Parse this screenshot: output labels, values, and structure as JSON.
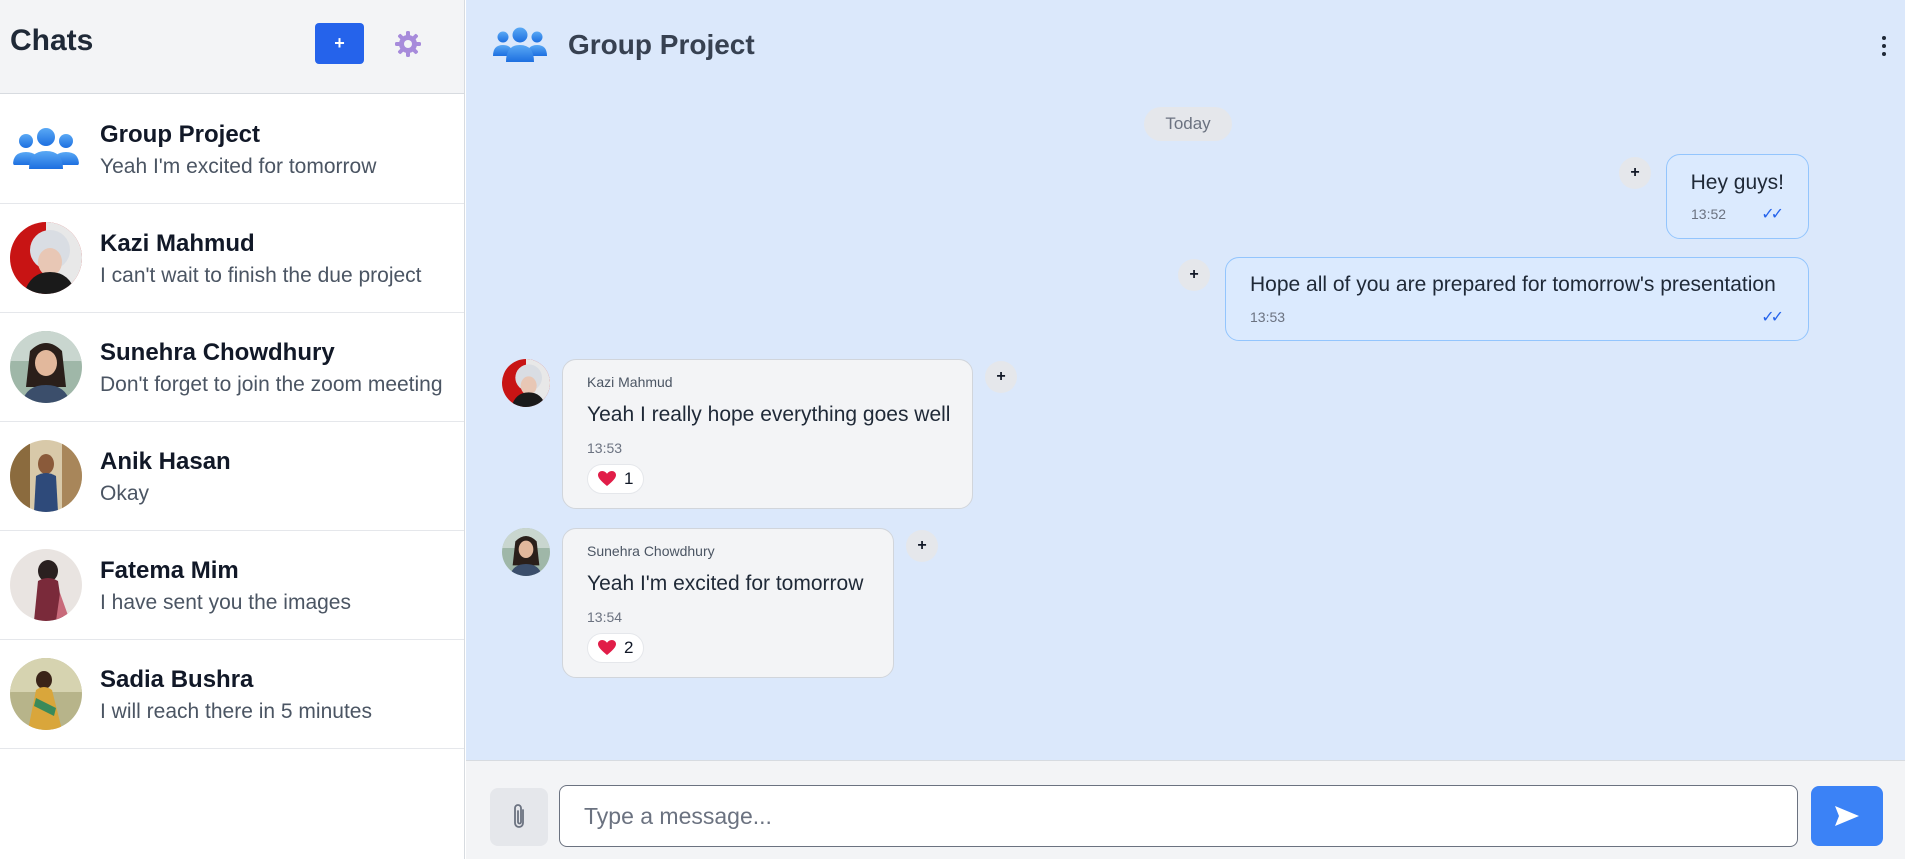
{
  "sidebar": {
    "title": "Chats",
    "new_chat_label": "+",
    "chats": [
      {
        "name": "Group Project",
        "preview": "Yeah I'm excited for tomorrow"
      },
      {
        "name": "Kazi Mahmud",
        "preview": "I can't wait to finish the due project"
      },
      {
        "name": "Sunehra Chowdhury",
        "preview": "Don't forget to join the zoom meeting"
      },
      {
        "name": "Anik Hasan",
        "preview": "Okay"
      },
      {
        "name": "Fatema Mim",
        "preview": "I have sent you the images"
      },
      {
        "name": "Sadia Bushra",
        "preview": "I will reach there in 5 minutes"
      }
    ]
  },
  "conversation": {
    "title": "Group Project",
    "date_label": "Today",
    "messages": [
      {
        "text": "Hey guys!",
        "time": "13:52",
        "status": "✓✓"
      },
      {
        "text": "Hope all of you are prepared for tomorrow's presentation",
        "time": "13:53",
        "status": "✓✓"
      },
      {
        "sender": "Kazi Mahmud",
        "text": "Yeah I really hope everything goes well",
        "time": "13:53",
        "reaction_count": "1"
      },
      {
        "sender": "Sunehra Chowdhury",
        "text": "Yeah I'm excited for tomorrow",
        "time": "13:54",
        "reaction_count": "2"
      }
    ],
    "add_reaction_label": "+"
  },
  "composer": {
    "placeholder": "Type a message..."
  },
  "colors": {
    "accent": "#2563eb",
    "send": "#3b82f6",
    "chat_bg": "#dbe8fb",
    "outgoing_bubble": "#dbeafe",
    "incoming_bubble": "#f3f4f6"
  }
}
